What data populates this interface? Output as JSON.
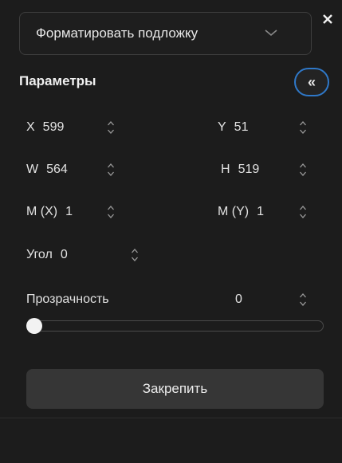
{
  "header": {
    "dropdown_value": "Форматировать подложку",
    "close_icon": "close-icon",
    "chevron_icon": "chevron-down-icon"
  },
  "params": {
    "title": "Параметры",
    "collapse_label": "«",
    "x": {
      "label": "X",
      "value": "599"
    },
    "y": {
      "label": "Y",
      "value": "51"
    },
    "w": {
      "label": "W",
      "value": "564"
    },
    "h": {
      "label": "H",
      "value": "519"
    },
    "mx": {
      "label": "M (X)",
      "value": "1"
    },
    "my": {
      "label": "M (Y)",
      "value": "1"
    },
    "angle": {
      "label": "Угол",
      "value": "0"
    },
    "opacity": {
      "label": "Прозрачность",
      "value": "0",
      "slider_fraction": 0
    }
  },
  "pin_button": "Закрепить",
  "colors": {
    "background": "#1c1c1c",
    "accent": "#2f78c8",
    "button": "#363636"
  }
}
